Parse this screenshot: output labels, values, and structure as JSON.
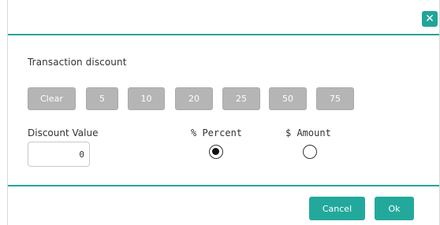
{
  "dialog": {
    "close_icon": "close-icon",
    "close_glyph": "✕"
  },
  "transaction": {
    "label": "Transaction discount"
  },
  "presets": [
    {
      "label": "Clear"
    },
    {
      "label": "5"
    },
    {
      "label": "10"
    },
    {
      "label": "20"
    },
    {
      "label": "25"
    },
    {
      "label": "50"
    },
    {
      "label": "75"
    }
  ],
  "discount": {
    "value_label": "Discount Value",
    "value": "0",
    "percent_label": "% Percent",
    "amount_label": "$ Amount",
    "selected": "percent"
  },
  "footer": {
    "cancel_label": "Cancel",
    "ok_label": "Ok"
  },
  "colors": {
    "accent": "#22a99c",
    "preset_bg": "#b5b5b5"
  }
}
